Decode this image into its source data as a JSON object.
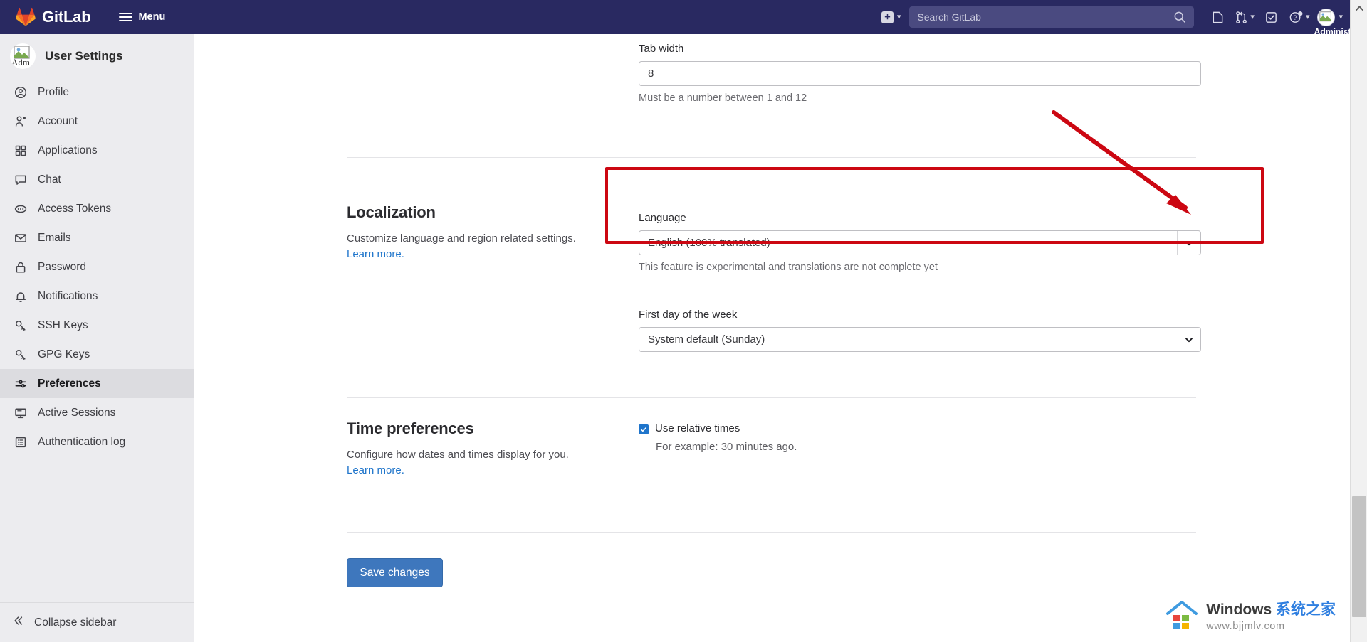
{
  "topbar": {
    "brand": "GitLab",
    "menu_label": "Menu",
    "search_placeholder": "Search GitLab",
    "icons": [
      {
        "name": "new-item-plus-icon",
        "label": "+"
      },
      {
        "name": "issues-icon",
        "label": ""
      },
      {
        "name": "merge-requests-icon",
        "label": ""
      },
      {
        "name": "todos-icon",
        "label": ""
      },
      {
        "name": "help-icon",
        "label": ""
      }
    ],
    "user_name": "Administrato",
    "avatar_alt": "Adm"
  },
  "sidebar": {
    "title": "User Settings",
    "avatar_alt": "Adm",
    "items": [
      {
        "label": "Profile",
        "icon": "user-circle-icon",
        "active": false
      },
      {
        "label": "Account",
        "icon": "account-icon",
        "active": false
      },
      {
        "label": "Applications",
        "icon": "grid-apps-icon",
        "active": false
      },
      {
        "label": "Chat",
        "icon": "chat-bubble-icon",
        "active": false
      },
      {
        "label": "Access Tokens",
        "icon": "token-icon",
        "active": false
      },
      {
        "label": "Emails",
        "icon": "envelope-icon",
        "active": false
      },
      {
        "label": "Password",
        "icon": "lock-icon",
        "active": false
      },
      {
        "label": "Notifications",
        "icon": "bell-icon",
        "active": false
      },
      {
        "label": "SSH Keys",
        "icon": "key-icon",
        "active": false
      },
      {
        "label": "GPG Keys",
        "icon": "key-icon",
        "active": false
      },
      {
        "label": "Preferences",
        "icon": "sliders-icon",
        "active": true
      },
      {
        "label": "Active Sessions",
        "icon": "monitor-icon",
        "active": false
      },
      {
        "label": "Authentication log",
        "icon": "log-list-icon",
        "active": false
      }
    ],
    "collapse_label": "Collapse sidebar"
  },
  "main": {
    "tab_width": {
      "label": "Tab width",
      "value": "8",
      "helper": "Must be a number between 1 and 12"
    },
    "localization": {
      "title": "Localization",
      "description": "Customize language and region related settings.",
      "learn_more": "Learn more.",
      "language_label": "Language",
      "language_value": "English (100% translated)",
      "language_helper": "This feature is experimental and translations are not complete yet",
      "first_day_label": "First day of the week",
      "first_day_value": "System default (Sunday)"
    },
    "time_preferences": {
      "title": "Time preferences",
      "description": "Configure how dates and times display for you.",
      "learn_more": "Learn more.",
      "checkbox_label": "Use relative times",
      "checkbox_checked": true,
      "checkbox_helper": "For example: 30 minutes ago."
    },
    "save_label": "Save changes"
  },
  "annotations": {
    "highlight_color": "#cc0712",
    "arrow_target": "language-select-dropdown-arrow"
  },
  "watermark": {
    "brand_en": "Windows ",
    "brand_cn": "系统之家",
    "url": "www.bjjmlv.com"
  }
}
